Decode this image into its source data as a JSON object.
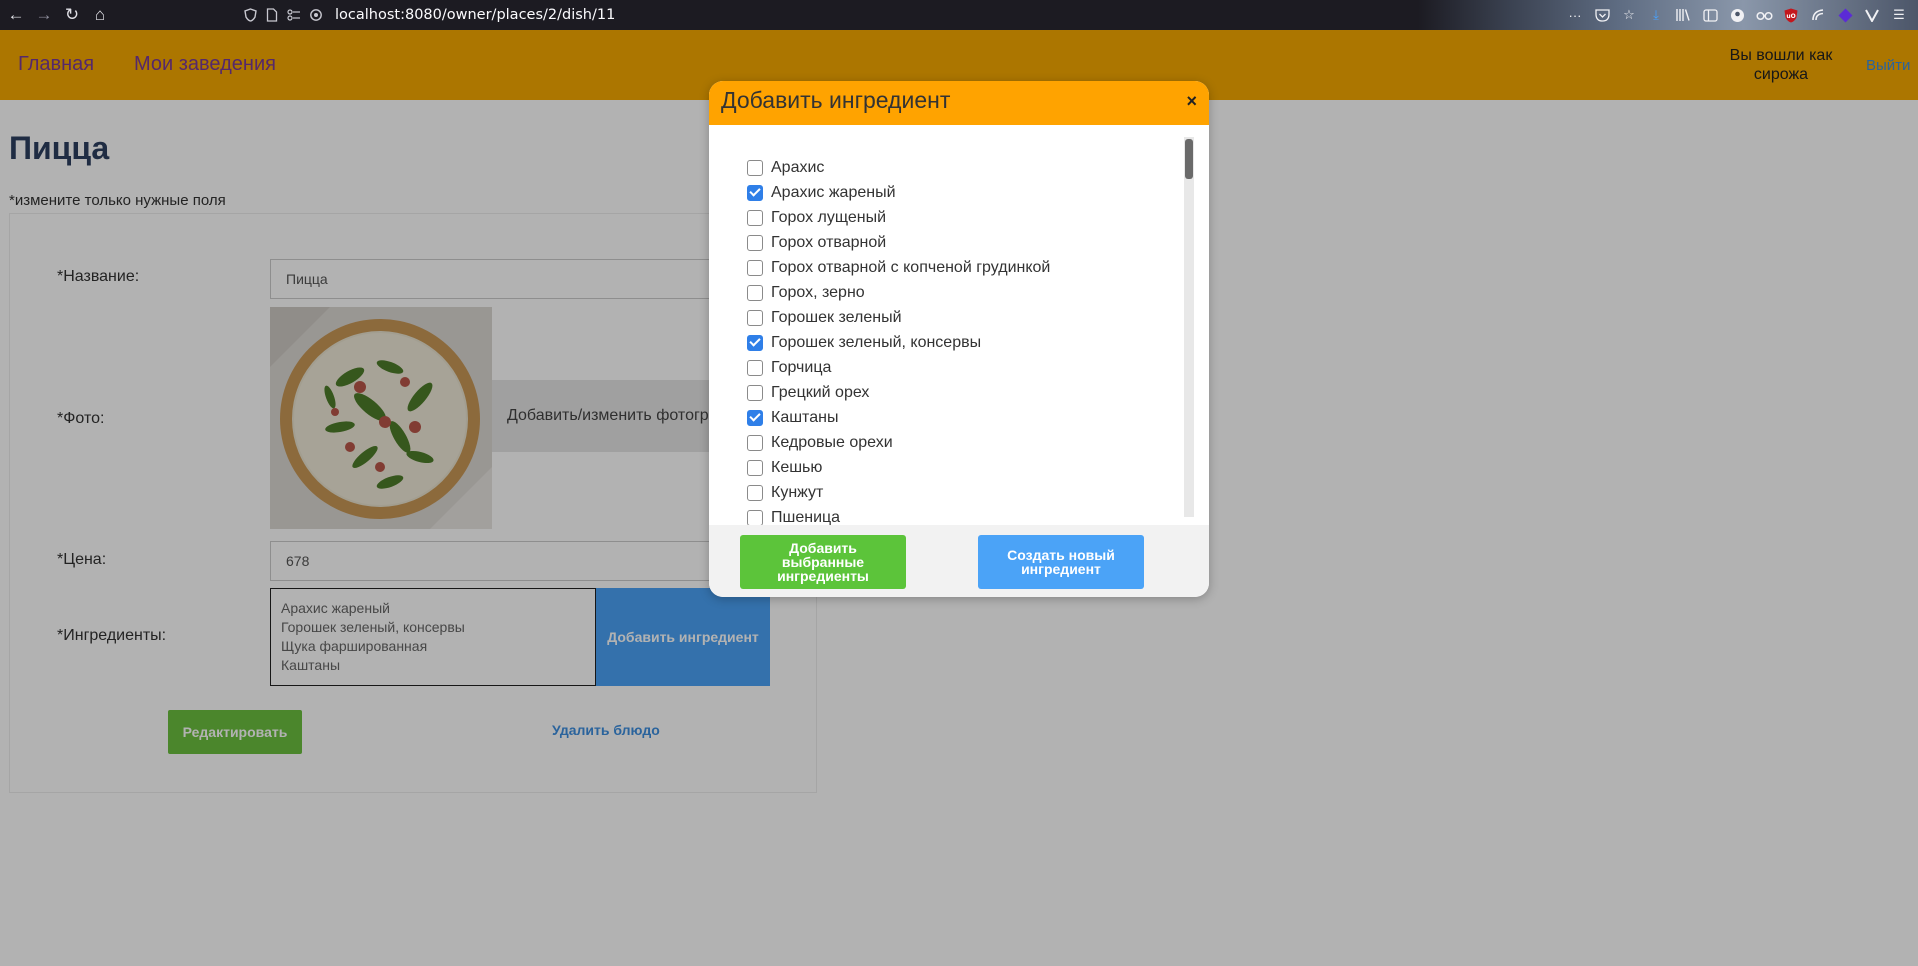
{
  "browser": {
    "url": "localhost:8080/owner/places/2/dish/11",
    "back_icon": "←",
    "forward_icon": "→",
    "reload_icon": "↻",
    "home_icon": "⌂",
    "more_icon": "···"
  },
  "header": {
    "nav": [
      {
        "label": "Главная"
      },
      {
        "label": "Мои заведения"
      }
    ],
    "user_info": "Вы вошли как сирожа",
    "logout": "Выйти"
  },
  "page": {
    "title": "Пицца",
    "hint": "*измените только нужные поля"
  },
  "form": {
    "name_label": "*Название:",
    "name_value": "Пицца",
    "photo_label": "*Фото:",
    "photo_button": "Добавить/изменить фотографию",
    "price_label": "*Цена:",
    "price_value": "678",
    "ingredients_label": "*Ингредиенты:",
    "ingredients": [
      "Арахис жареный",
      "Горошек зеленый, консервы",
      "Щука фаршированная",
      "Каштаны"
    ],
    "add_ingredient_button": "Добавить ингредиент",
    "edit_button": "Редактировать",
    "delete_link": "Удалить блюдо"
  },
  "modal": {
    "title": "Добавить ингредиент",
    "close": "×",
    "options": [
      {
        "label": "Арахис",
        "checked": false
      },
      {
        "label": "Арахис жареный",
        "checked": true
      },
      {
        "label": "Горох лущеный",
        "checked": false
      },
      {
        "label": "Горох отварной",
        "checked": false
      },
      {
        "label": "Горох отварной с копченой грудинкой",
        "checked": false
      },
      {
        "label": "Горох, зерно",
        "checked": false
      },
      {
        "label": "Горошек зеленый",
        "checked": false
      },
      {
        "label": "Горошек зеленый, консервы",
        "checked": true
      },
      {
        "label": "Горчица",
        "checked": false
      },
      {
        "label": "Грецкий орех",
        "checked": false
      },
      {
        "label": "Каштаны",
        "checked": true
      },
      {
        "label": "Кедровые орехи",
        "checked": false
      },
      {
        "label": "Кешью",
        "checked": false
      },
      {
        "label": "Кунжут",
        "checked": false
      },
      {
        "label": "Пшеница",
        "checked": false
      }
    ],
    "add_selected_button": "Добавить выбранные ингредиенты",
    "create_new_button": "Создать новый ингредиент"
  },
  "colors": {
    "header_bg": "#f7a900",
    "modal_header_bg": "#ffa300",
    "green_button": "#5cc43a",
    "blue_button": "#4ba3f7",
    "nav_link": "#7a3a9a",
    "checkbox_checked": "#2f7fe8"
  }
}
